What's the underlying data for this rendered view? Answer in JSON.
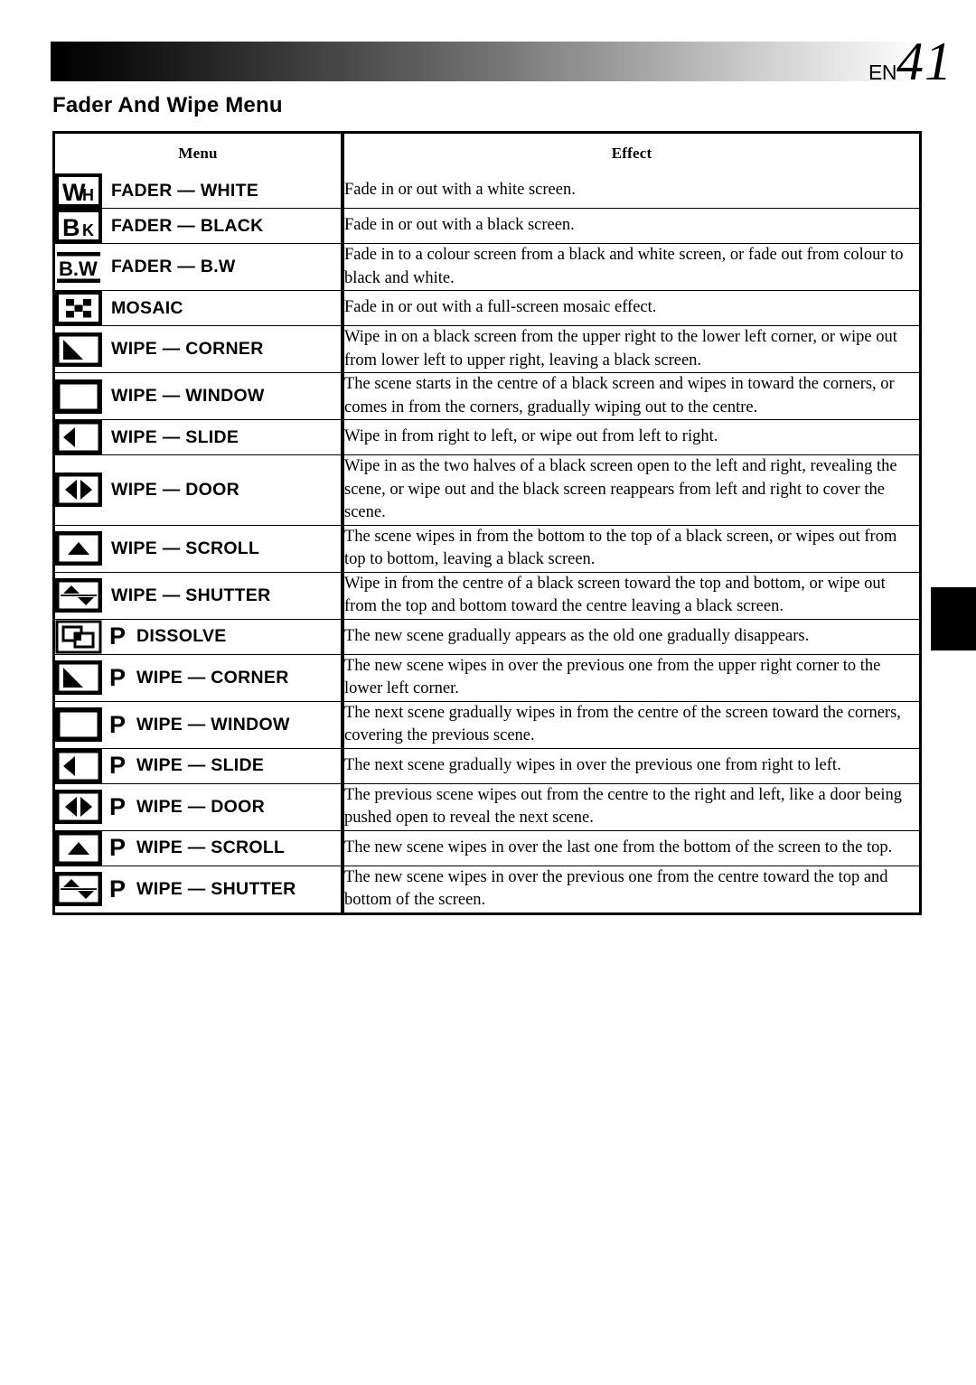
{
  "header": {
    "page_prefix": "EN",
    "page_number": "41"
  },
  "section": {
    "title": "Fader And Wipe Menu"
  },
  "table": {
    "columns": [
      "Menu",
      "Effect"
    ],
    "rows": [
      {
        "icon": "fader-white-icon",
        "icon_text": "WH",
        "has_p": false,
        "label": "FADER — WHITE",
        "effect": "Fade in or out with a white screen."
      },
      {
        "icon": "fader-black-icon",
        "icon_text": "BK",
        "has_p": false,
        "label": "FADER — BLACK",
        "effect": "Fade in or out with a black screen."
      },
      {
        "icon": "fader-bw-icon",
        "icon_text": "B.W",
        "has_p": false,
        "label": "FADER — B.W",
        "effect": "Fade in to a colour screen from a black and white screen, or fade out from colour to black and white."
      },
      {
        "icon": "mosaic-icon",
        "icon_text": "",
        "has_p": false,
        "label": "MOSAIC",
        "effect": "Fade in or out with a full-screen mosaic effect."
      },
      {
        "icon": "wipe-corner-icon",
        "icon_text": "",
        "has_p": false,
        "label": "WIPE — CORNER",
        "effect": "Wipe in on a black screen from the upper right to the lower left corner, or wipe out from lower left to upper right, leaving a black screen."
      },
      {
        "icon": "wipe-window-icon",
        "icon_text": "",
        "has_p": false,
        "label": "WIPE — WINDOW",
        "effect": "The scene starts in the centre of a black screen and wipes in toward the corners, or comes in from the corners, gradually wiping out to the centre."
      },
      {
        "icon": "wipe-slide-icon",
        "icon_text": "",
        "has_p": false,
        "label": "WIPE — SLIDE",
        "effect": "Wipe in from right to left, or wipe out from left to right."
      },
      {
        "icon": "wipe-door-icon",
        "icon_text": "",
        "has_p": false,
        "label": "WIPE — DOOR",
        "effect": "Wipe in as the two halves of a black screen open to the left and right, revealing the scene, or wipe out and the black screen reappears from left and right to cover the scene."
      },
      {
        "icon": "wipe-scroll-icon",
        "icon_text": "",
        "has_p": false,
        "label": "WIPE — SCROLL",
        "effect": "The scene wipes in from the bottom to the top of a black screen, or wipes out from top to bottom, leaving a black screen."
      },
      {
        "icon": "wipe-shutter-icon",
        "icon_text": "",
        "has_p": false,
        "label": "WIPE — SHUTTER",
        "effect": "Wipe in from the centre of a black screen toward the top and bottom, or wipe out from the top and bottom toward the centre leaving a black screen."
      },
      {
        "icon": "dissolve-icon",
        "icon_text": "",
        "has_p": true,
        "p_label": "P",
        "label": "DISSOLVE",
        "effect": "The new scene gradually appears as the old one gradually disappears."
      },
      {
        "icon": "wipe-corner-p-icon",
        "icon_text": "",
        "has_p": true,
        "p_label": "P",
        "label": "WIPE — CORNER",
        "effect": "The new scene wipes in over the previous one from the upper right corner to the lower left corner."
      },
      {
        "icon": "wipe-window-p-icon",
        "icon_text": "",
        "has_p": true,
        "p_label": "P",
        "label": "WIPE — WINDOW",
        "effect": "The next scene gradually wipes in from the centre of the screen toward the corners, covering the previous scene."
      },
      {
        "icon": "wipe-slide-p-icon",
        "icon_text": "",
        "has_p": true,
        "p_label": "P",
        "label": "WIPE — SLIDE",
        "effect": "The next scene gradually wipes in over the previous one from right to left."
      },
      {
        "icon": "wipe-door-p-icon",
        "icon_text": "",
        "has_p": true,
        "p_label": "P",
        "label": "WIPE — DOOR",
        "effect": "The previous scene wipes out from the centre to the right and left, like a door being pushed open to reveal the next scene."
      },
      {
        "icon": "wipe-scroll-p-icon",
        "icon_text": "",
        "has_p": true,
        "p_label": "P",
        "label": "WIPE — SCROLL",
        "effect": "The new scene wipes in over the last one from the bottom of the screen to the top."
      },
      {
        "icon": "wipe-shutter-p-icon",
        "icon_text": "",
        "has_p": true,
        "p_label": "P",
        "label": "WIPE — SHUTTER",
        "effect": "The new scene wipes in over the previous one from the centre toward the top and bottom of the screen."
      }
    ]
  },
  "colors": {
    "ink": "#000000",
    "paper": "#ffffff"
  }
}
